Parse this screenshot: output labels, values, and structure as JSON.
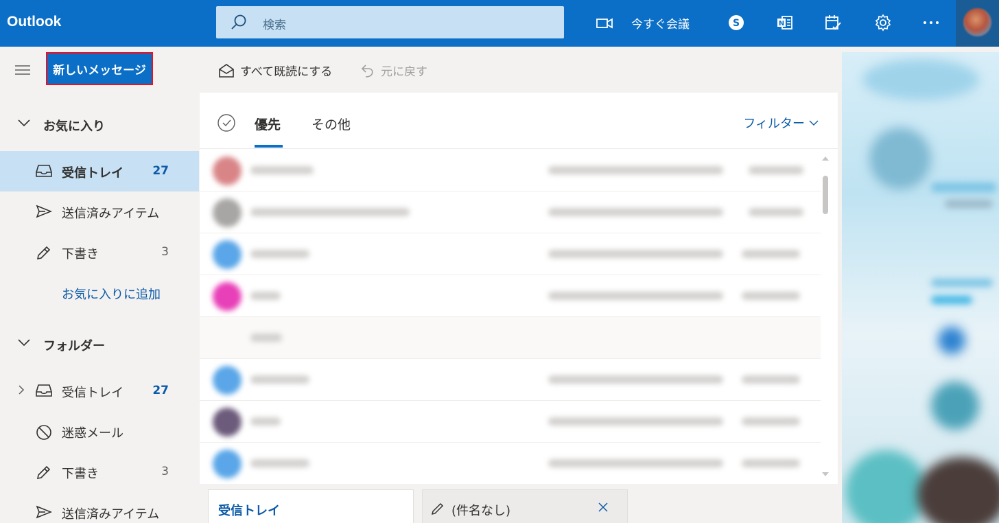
{
  "app": {
    "title": "Outlook"
  },
  "search": {
    "placeholder": "検索"
  },
  "header": {
    "meet_now_label": "今すぐ会議"
  },
  "nav": {
    "new_message_label": "新しいメッセージ",
    "favorites": {
      "title": "お気に入り",
      "items": [
        {
          "label": "受信トレイ",
          "count": "27"
        },
        {
          "label": "送信済みアイテム",
          "count": ""
        },
        {
          "label": "下書き",
          "count": "3"
        }
      ],
      "add_label": "お気に入りに追加"
    },
    "folders": {
      "title": "フォルダー",
      "items": [
        {
          "label": "受信トレイ",
          "count": "27"
        },
        {
          "label": "迷惑メール",
          "count": ""
        },
        {
          "label": "下書き",
          "count": "3"
        },
        {
          "label": "送信済みアイテム",
          "count": ""
        }
      ]
    }
  },
  "command_bar": {
    "mark_all_read_label": "すべて既読にする",
    "undo_label": "元に戻す"
  },
  "message_list": {
    "tabs": [
      {
        "label": "優先"
      },
      {
        "label": "その他"
      }
    ],
    "filter_label": "フィルター"
  },
  "bottom_tabs": {
    "inbox_label": "受信トレイ",
    "draft_label": "(件名なし)"
  },
  "colors": {
    "brand": "#0b6fc7",
    "selection": "#c7e0f4",
    "highlight_border": "#e81123"
  }
}
